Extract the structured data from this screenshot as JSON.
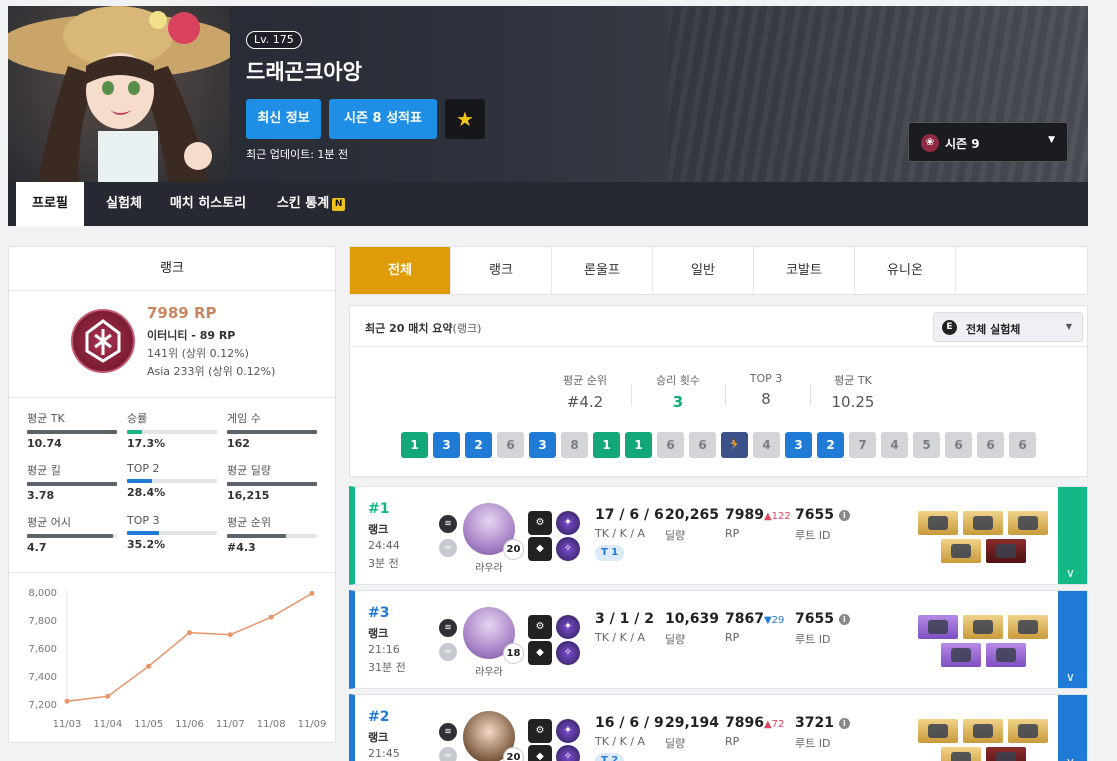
{
  "header": {
    "level": "Lv. 175",
    "player_name": "드래곤크아앙",
    "btn_latest": "최신 정보",
    "btn_season_report": "시즌 8 성적표",
    "star_icon": "star-icon",
    "last_update": "최근 업데이트: 1분 전",
    "season_select": "시즌 9"
  },
  "tabs": [
    "프로필",
    "실험체",
    "매치 히스토리",
    "스킨 통계"
  ],
  "tab_new_badge": "N",
  "rank_panel": {
    "title": "랭크",
    "rp": "7989 RP",
    "tier": "이터니티 - 89 RP",
    "global_rank": "141위 (상위 0.12%)",
    "region_rank": "Asia 233위 (상위 0.12%)",
    "stats": [
      {
        "label": "평균 TK",
        "value": "10.74",
        "fill": 1.0
      },
      {
        "label": "승률",
        "value": "17.3%",
        "fill": 0.17
      },
      {
        "label": "게임 수",
        "value": "162",
        "fill": 1.0
      },
      {
        "label": "평균 킬",
        "value": "3.78",
        "fill": 1.0
      },
      {
        "label": "TOP 2",
        "value": "28.4%",
        "fill": 0.28
      },
      {
        "label": "평균 딜량",
        "value": "16,215",
        "fill": 1.0
      },
      {
        "label": "평균 어시",
        "value": "4.7",
        "fill": 0.95
      },
      {
        "label": "TOP 3",
        "value": "35.2%",
        "fill": 0.35
      },
      {
        "label": "평균 순위",
        "value": "#4.3",
        "fill": 0.65
      }
    ]
  },
  "chart_data": {
    "type": "line",
    "x": [
      "11/03",
      "11/04",
      "11/05",
      "11/06",
      "11/07",
      "11/08",
      "11/09"
    ],
    "values": [
      7220,
      7255,
      7470,
      7710,
      7695,
      7820,
      7990
    ],
    "yticks": [
      "8,000",
      "7,800",
      "7,600",
      "7,400",
      "7,200"
    ],
    "ylim": [
      7200,
      8000
    ],
    "color": "#e8956a"
  },
  "mode_tabs": [
    "전체",
    "랭크",
    "론울프",
    "일반",
    "코발트",
    "유니온"
  ],
  "summary": {
    "title": "최근 20 매치 요약",
    "title_suffix": "(랭크)",
    "character_filter": "전체 실험체",
    "stats": [
      {
        "label": "평균 순위",
        "value": "#4.2"
      },
      {
        "label": "승리 횟수",
        "value": "3"
      },
      {
        "label": "TOP 3",
        "value": "8"
      },
      {
        "label": "평균 TK",
        "value": "10.25"
      }
    ],
    "placements": [
      "1",
      "3",
      "2",
      "6",
      "3",
      "8",
      "1",
      "1",
      "6",
      "6",
      "escape",
      "4",
      "3",
      "2",
      "7",
      "4",
      "5",
      "6",
      "6",
      "6"
    ]
  },
  "matches": [
    {
      "rank": "#1",
      "mode": "랭크",
      "time": "24:44",
      "ago": "3분 전",
      "character": "라우라",
      "level": "20",
      "kda": "17 / 6 / 6",
      "kda_label": "TK / K / A",
      "team_badge": "T 1",
      "damage": "20,265",
      "damage_label": "딜량",
      "rp": "7989",
      "rp_delta": "▲122",
      "rp_label": "RP",
      "route": "7655",
      "route_label": "루트 ID",
      "color": "#13b886"
    },
    {
      "rank": "#3",
      "mode": "랭크",
      "time": "21:16",
      "ago": "31분 전",
      "character": "라우라",
      "level": "18",
      "kda": "3 / 1 / 2",
      "kda_label": "TK / K / A",
      "team_badge": "",
      "damage": "10,639",
      "damage_label": "딜량",
      "rp": "7867",
      "rp_delta": "▼29",
      "rp_label": "RP",
      "route": "7655",
      "route_label": "루트 ID",
      "color": "#1f7bd6"
    },
    {
      "rank": "#2",
      "mode": "랭크",
      "time": "21:45",
      "ago": "",
      "character": "",
      "level": "20",
      "kda": "16 / 6 / 9",
      "kda_label": "TK / K / A",
      "team_badge": "T 2",
      "damage": "29,194",
      "damage_label": "딜량",
      "rp": "7896",
      "rp_delta": "▲72",
      "rp_label": "RP",
      "route": "3721",
      "route_label": "루트 ID",
      "color": "#1f7bd6"
    }
  ]
}
